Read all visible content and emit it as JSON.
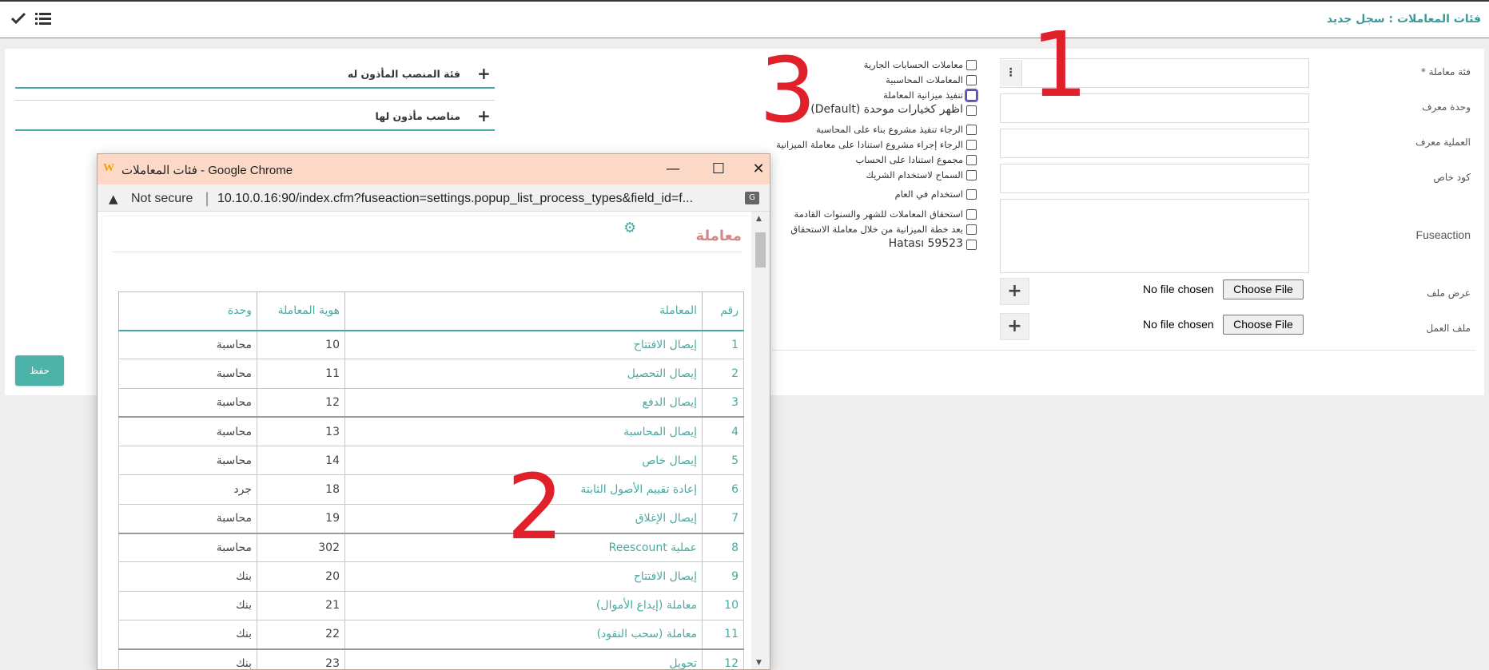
{
  "header": {
    "title": "فئات المعاملات : سجل جديد"
  },
  "form": {
    "fields": [
      {
        "label": "فئة معاملة *",
        "value": ""
      },
      {
        "label": "وحدة معرف",
        "value": ""
      },
      {
        "label": "العملية معرف",
        "value": ""
      },
      {
        "label": "كود خاص",
        "value": ""
      },
      {
        "label": "Fuseaction",
        "value": ""
      }
    ],
    "files": [
      {
        "label": "عرض ملف",
        "status": "No file chosen",
        "button": "Choose File"
      },
      {
        "label": "ملف العمل",
        "status": "No file chosen",
        "button": "Choose File"
      }
    ],
    "dots_glyph": "⋮",
    "plus_glyph": "+",
    "checkboxes": [
      "معاملات الحسابات الجارية",
      "المعاملات المحاسبية",
      "تنفيذ ميزانية المعاملة",
      "اظهر كخيارات موحدة (Default)",
      "الرجاء تنفيذ مشروع بناء على المحاسبة",
      "الرجاء إجراء مشروع استنادا على معاملة الميزانية",
      "مجموع استنادا على الحساب",
      "السماح لاستخدام الشريك",
      "استخدام في العام",
      "استحقاق المعاملات للشهر والسنوات القادمة",
      "بعد خطة الميزانية من خلال معاملة الاستحقاق",
      "Hatası 59523"
    ],
    "save_label": "حفظ"
  },
  "sections": [
    {
      "title": "فئة المنصب المأذون له"
    },
    {
      "title": "مناصب مأذون لها"
    }
  ],
  "annotations": {
    "one": "1",
    "two": "2",
    "three": "3"
  },
  "popup": {
    "logo": "W",
    "window_title": "فئات المعاملات - Google Chrome",
    "minimize": "—",
    "maximize": "☐",
    "close": "✕",
    "security": "Not secure",
    "url": "10.10.0.16:90/index.cfm?fuseaction=settings.popup_list_process_types&field_id=f...",
    "heading": "معاملة",
    "columns": [
      "رقم",
      "المعاملة",
      "هوية المعاملة",
      "وحدة"
    ],
    "rows": [
      [
        "1",
        "إيصال الافتتاح",
        "10",
        "محاسبة"
      ],
      [
        "2",
        "إيصال التحصيل",
        "11",
        "محاسبة"
      ],
      [
        "3",
        "إيصال الدفع",
        "12",
        "محاسبة"
      ],
      [
        "4",
        "إيصال المحاسبة",
        "13",
        "محاسبة"
      ],
      [
        "5",
        "إيصال خاص",
        "14",
        "محاسبة"
      ],
      [
        "6",
        "إعادة تقييم الأصول الثابتة",
        "18",
        "جرد"
      ],
      [
        "7",
        "إيصال الإغلاق",
        "19",
        "محاسبة"
      ],
      [
        "8",
        "عملية Reescount",
        "302",
        "محاسبة"
      ],
      [
        "9",
        "إيصال الافتتاح",
        "20",
        "بنك"
      ],
      [
        "10",
        "معاملة (إيداع الأموال)",
        "21",
        "بنك"
      ],
      [
        "11",
        "معاملة (سحب النقود)",
        "22",
        "بنك"
      ],
      [
        "12",
        "تحويل",
        "23",
        "بنك"
      ]
    ]
  },
  "colors": {
    "accent": "#4aa9a0",
    "save": "#4db3a8",
    "annotation": "#e0202a",
    "popup_titlebar": "#fbd9c6"
  }
}
